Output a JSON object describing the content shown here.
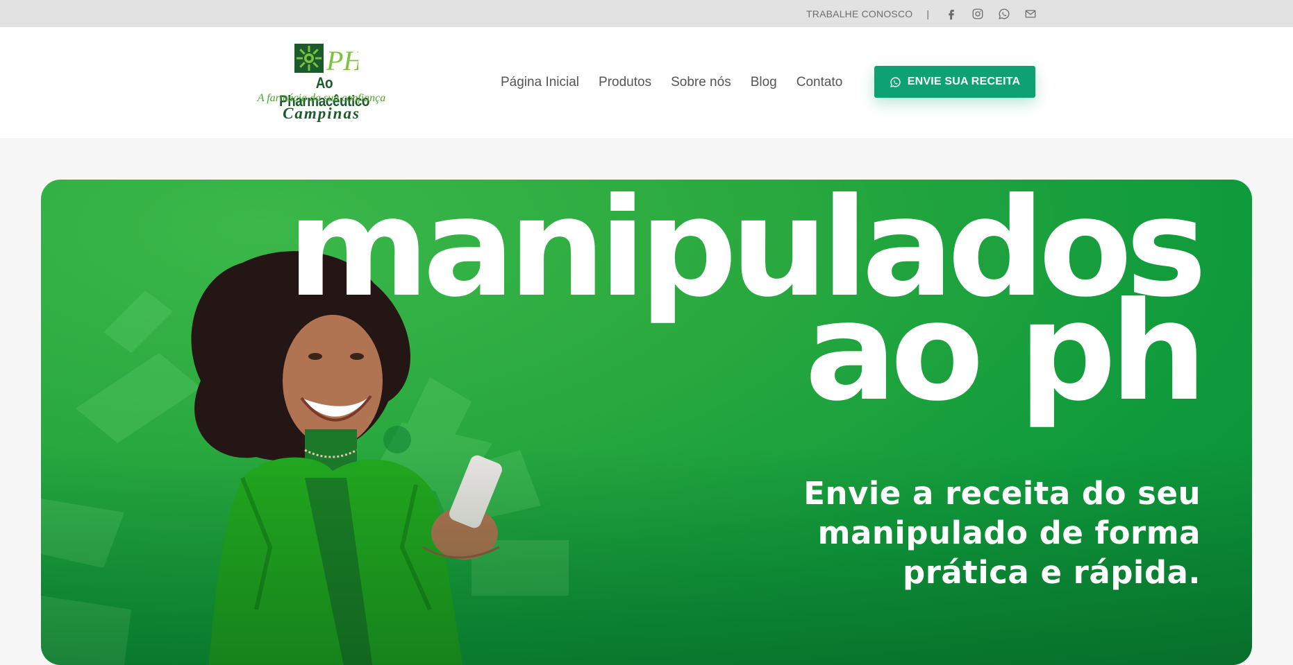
{
  "topbar": {
    "work_with_us": "TRABALHE CONOSCO",
    "separator": "|",
    "social_icons": [
      "facebook-icon",
      "instagram-icon",
      "whatsapp-icon",
      "mail-icon"
    ]
  },
  "header": {
    "logo": {
      "name": "Ao Pharmacêutico",
      "tagline": "A farmácia da sua confiança",
      "city": "Campinas",
      "monogram": "PH"
    },
    "nav": [
      {
        "label": "Página Inicial"
      },
      {
        "label": "Produtos"
      },
      {
        "label": "Sobre nós"
      },
      {
        "label": "Blog"
      },
      {
        "label": "Contato"
      }
    ],
    "cta": {
      "label": "ENVIE SUA RECEITA",
      "icon": "whatsapp-icon"
    }
  },
  "hero": {
    "title_line1": "manipulados",
    "title_line2": "ao ph",
    "subtitle_lines": [
      "Envie a receita do seu",
      "manipulado de forma",
      "prática e rápida."
    ],
    "image": "smiling-woman-with-phone"
  },
  "colors": {
    "topbar_bg": "#e2e2e2",
    "brand_green_dark": "#1c5a2c",
    "brand_green_light": "#4aa52c",
    "cta_bg": "#0ea272",
    "hero_green": "#1fa43e"
  }
}
